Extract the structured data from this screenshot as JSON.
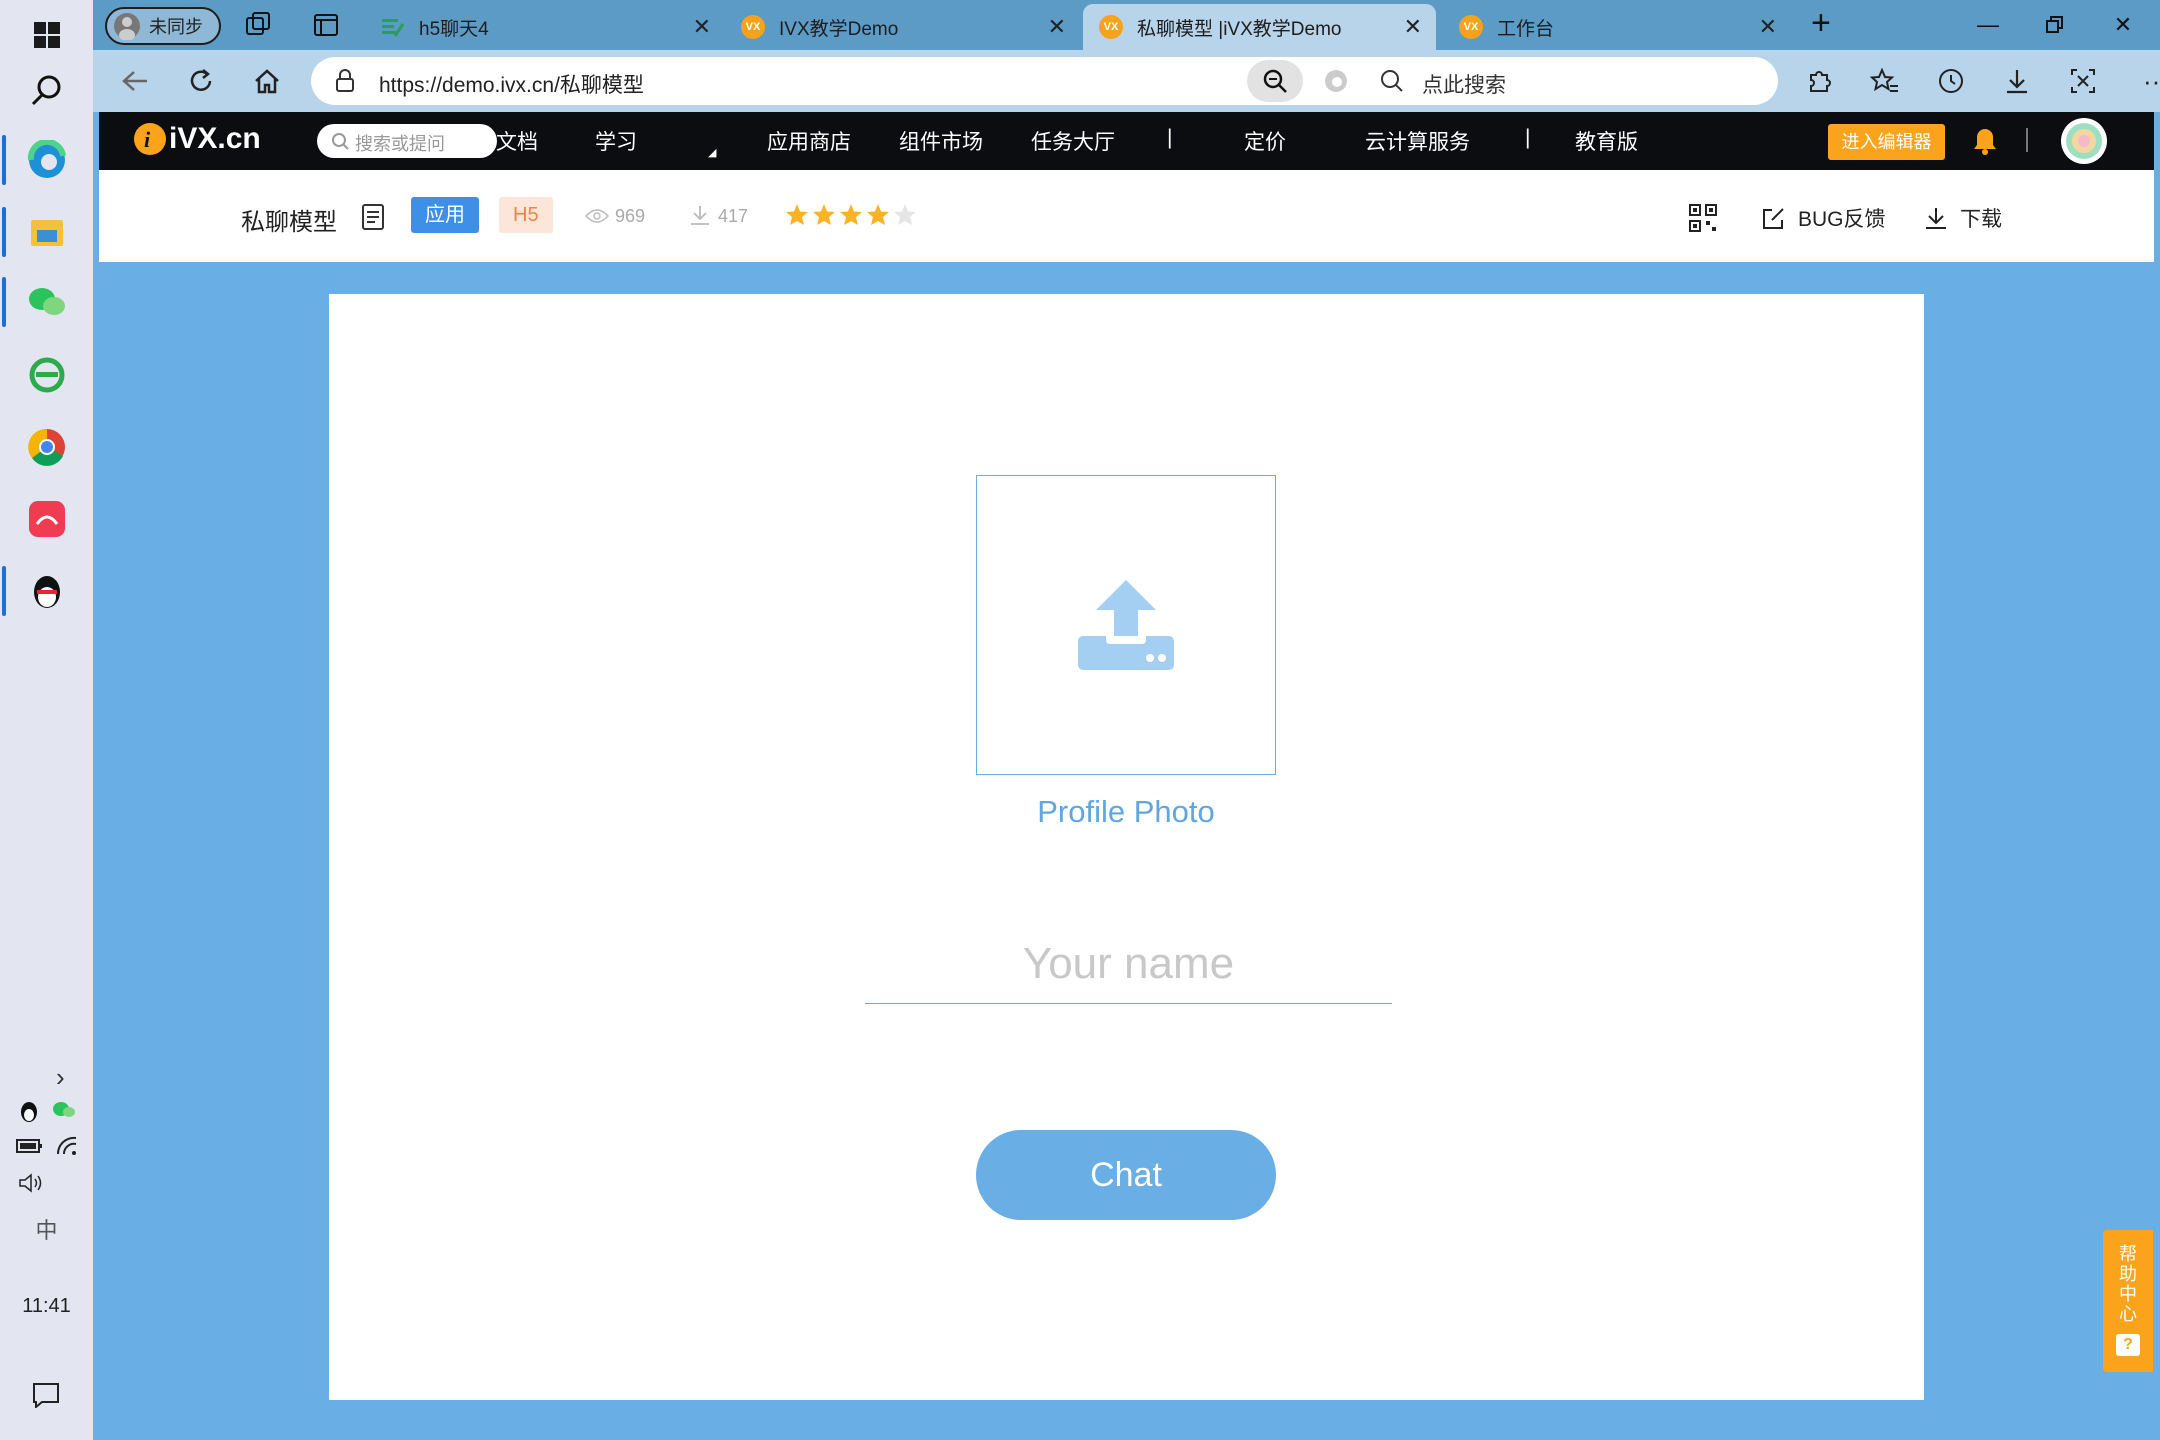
{
  "taskbar": {
    "time": "11:41",
    "ime": "中"
  },
  "browser": {
    "profile": "未同步",
    "tabs": [
      {
        "label": "h5聊天4"
      },
      {
        "label": "IVX教学Demo"
      },
      {
        "label": "私聊模型 |iVX教学Demo"
      },
      {
        "label": "工作台"
      }
    ],
    "url": "https://demo.ivx.cn/私聊模型",
    "search_placeholder": "点此搜索"
  },
  "site": {
    "logo": "iVX.cn",
    "search_placeholder": "搜索或提问",
    "nav": [
      "文档",
      "学习",
      "应用商店",
      "组件市场",
      "任务大厅",
      "|",
      "定价",
      "云计算服务",
      "|",
      "教育版"
    ],
    "editor_button": "进入编辑器"
  },
  "app": {
    "title": "私聊模型",
    "badge_app": "应用",
    "badge_h5": "H5",
    "views": "969",
    "downloads": "417",
    "rating": 4,
    "bug_feedback": "BUG反馈",
    "download": "下载"
  },
  "canvas": {
    "profile_photo_label": "Profile Photo",
    "name_placeholder": "Your name",
    "chat_button": "Chat"
  },
  "help_center": "帮助中心",
  "colors": {
    "accent": "#6aaee6",
    "orange": "#fba41b",
    "nav_bg": "#0c0d10"
  }
}
